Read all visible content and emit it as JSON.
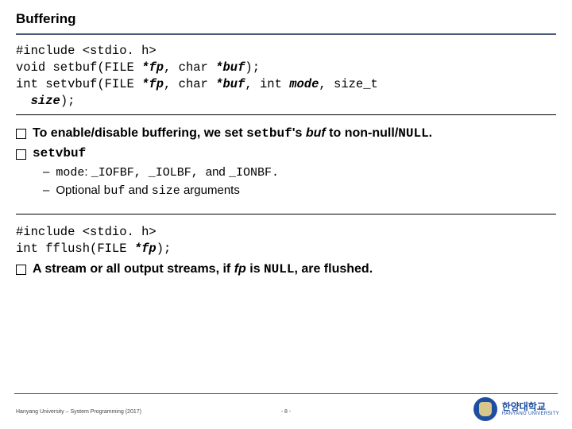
{
  "title": "Buffering",
  "code1": {
    "line1": "#include <stdio. h>",
    "line2_a": "void setbuf(FILE ",
    "line2_b": "*fp",
    "line2_c": ", char ",
    "line2_d": "*buf",
    "line2_e": ");",
    "line3_a": "int setvbuf(FILE ",
    "line3_b": "*fp",
    "line3_c": ", char ",
    "line3_d": "*buf",
    "line3_e": ", int ",
    "line3_f": "mode",
    "line3_g": ", size_t",
    "line4_a": "size",
    "line4_b": ");"
  },
  "bullet1": {
    "a": "To enable/disable buffering, we set ",
    "b": "setbuf",
    "c": "'s ",
    "d": "buf",
    "e": " to non-null/",
    "f": "NULL",
    "g": "."
  },
  "bullet2": "setvbuf",
  "sub1": {
    "a": "mode",
    "b": ": ",
    "c": "_IOFBF, _IOLBF, ",
    "d": "and ",
    "e": "_IONBF."
  },
  "sub2": {
    "a": "Optional ",
    "b": "buf",
    "c": " and ",
    "d": "size",
    "e": " arguments"
  },
  "code2": {
    "line1": "#include <stdio. h>",
    "line2_a": "int fflush(FILE ",
    "line2_b": "*fp",
    "line2_c": ");"
  },
  "bullet3": {
    "a": "A stream or all output streams, if ",
    "b": "fp",
    "c": " is ",
    "d": "NULL",
    "e": ", are flushed."
  },
  "footer": "Hanyang University – System Programming (2017)",
  "pagenum": "- 8 -",
  "logo_kr": "한양대학교",
  "logo_en": "HANYANG UNIVERSITY"
}
